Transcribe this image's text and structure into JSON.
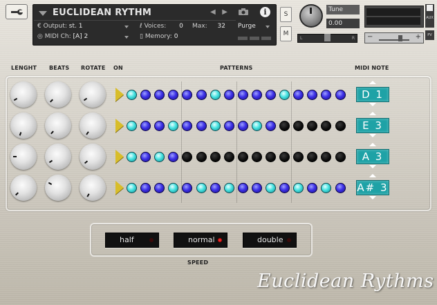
{
  "header": {
    "instrument_title": "EUCLIDEAN RYTHM",
    "output_label": "Output:",
    "output_value": "st. 1",
    "voices_label": "Voices:",
    "voices_value": "0",
    "max_label": "Max:",
    "max_value": "32",
    "purge_label": "Purge",
    "midi_label": "MIDI Ch:",
    "midi_value": "[A]  2",
    "memory_label": "Memory:",
    "memory_value": "0",
    "solo_label": "S",
    "mute_label": "M",
    "tune_label": "Tune",
    "tune_value": "0.00",
    "pan_left": "L",
    "pan_right": "R",
    "aux_label": "AUX",
    "pv_label": "PV",
    "vol_minus": "−",
    "vol_plus": "+"
  },
  "labels": {
    "length": "LENGHT",
    "beats": "BEATS",
    "rotate": "ROTATE",
    "on": "ON",
    "patterns": "PATTERNS",
    "midi_note": "MIDI NOTE",
    "speed": "SPEED"
  },
  "tracks": [
    {
      "note": "D 1",
      "steps": [
        "hit",
        "on",
        "on",
        "on",
        "on",
        "on",
        "hit",
        "on",
        "on",
        "on",
        "on",
        "hit",
        "on",
        "on",
        "on",
        "on"
      ]
    },
    {
      "note": "E 3",
      "steps": [
        "hit",
        "on",
        "on",
        "hit",
        "on",
        "on",
        "hit",
        "on",
        "on",
        "hit",
        "on",
        "off",
        "off",
        "off",
        "off",
        "off"
      ]
    },
    {
      "note": "A 3",
      "steps": [
        "hit",
        "on",
        "hit",
        "on",
        "off",
        "off",
        "off",
        "off",
        "off",
        "off",
        "off",
        "off",
        "off",
        "off",
        "off",
        "off"
      ]
    },
    {
      "note": "A# 3",
      "steps": [
        "hit",
        "on",
        "on",
        "hit",
        "on",
        "hit",
        "on",
        "hit",
        "on",
        "on",
        "hit",
        "on",
        "hit",
        "on",
        "hit",
        "on"
      ]
    }
  ],
  "speed": {
    "options": [
      "half",
      "normal",
      "double"
    ],
    "selected": "normal"
  },
  "signature": "Euclidean Rythms",
  "colors": {
    "step_on": "#3c30e6",
    "step_hit": "#46e3e1",
    "step_off": "#0b0b0b",
    "note_box": "#1ea2a6",
    "play_arrow": "#d8bd2a",
    "led_active": "#ff3a3a"
  }
}
